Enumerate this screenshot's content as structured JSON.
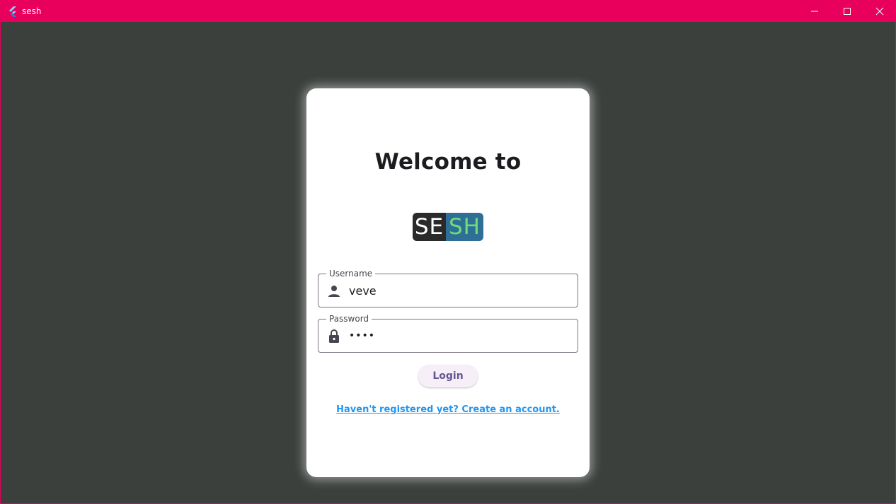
{
  "window": {
    "title": "sesh",
    "accent_color": "#e8005c",
    "background_color": "#3b403d",
    "controls": {
      "minimize_icon": "minimize-icon",
      "maximize_icon": "maximize-icon",
      "close_icon": "close-icon"
    }
  },
  "login": {
    "heading": "Welcome to",
    "logo": {
      "left_text": "SE",
      "right_text": "SH"
    },
    "username": {
      "label": "Username",
      "value": "veve",
      "icon": "person-icon"
    },
    "password": {
      "label": "Password",
      "value": "••••",
      "icon": "lock-icon"
    },
    "login_button": "Login",
    "register_link": "Haven't registered yet? Create an account."
  }
}
